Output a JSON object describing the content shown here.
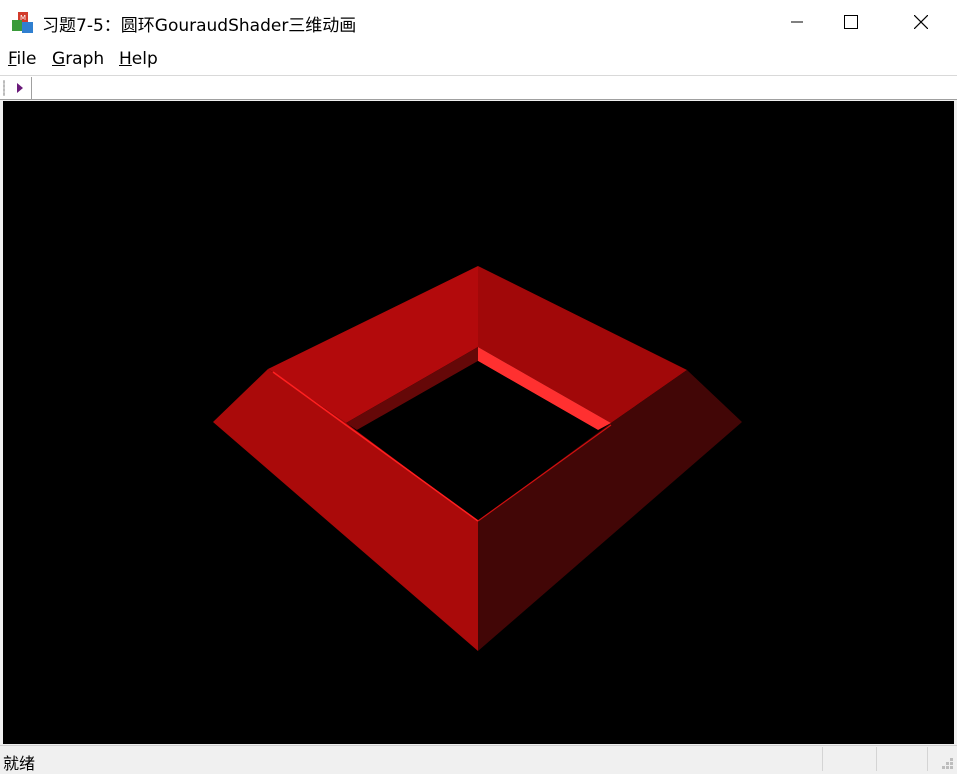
{
  "window": {
    "title": "习题7-5：圆环GouraudShader三维动画",
    "icon": "mfc-app-icon",
    "controls": [
      "minimize-icon",
      "maximize-icon",
      "close-icon"
    ]
  },
  "menu": {
    "items": [
      {
        "label_u": "F",
        "label_rest": "ile"
      },
      {
        "label_u": "G",
        "label_rest": "raph"
      },
      {
        "label_u": "H",
        "label_rest": "elp"
      }
    ]
  },
  "toolbar": {
    "play_icon": "play-icon",
    "play_color": "#6a1a7a"
  },
  "scene": {
    "background": "#000000",
    "colors": {
      "top_left": "#b30a0c",
      "top_right": "#a10809",
      "front_left": "#aa0a0a",
      "front_right": "#420606",
      "inner_left": "#650808",
      "inner_right": "#ff3030",
      "edge": "#ff2020"
    }
  },
  "statusbar": {
    "text": "就绪"
  }
}
